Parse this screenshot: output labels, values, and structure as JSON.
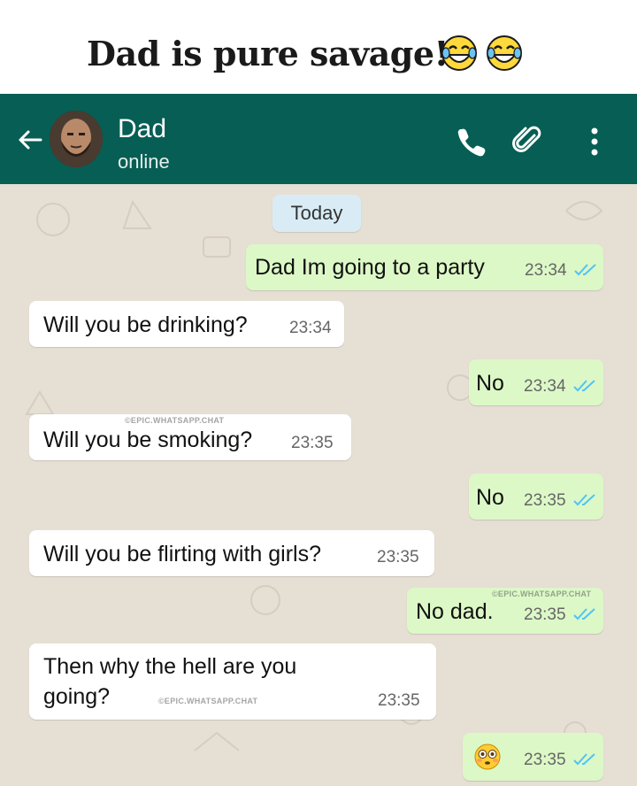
{
  "caption": {
    "text": "Dad is pure savage!",
    "emojis": [
      "tears-of-joy-emoji",
      "tears-of-joy-emoji"
    ]
  },
  "header": {
    "contact_name": "Dad",
    "status": "online",
    "icons": [
      "back-arrow-icon",
      "avatar",
      "phone-icon",
      "paperclip-icon",
      "more-vert-icon"
    ],
    "color": "#075e54"
  },
  "chat": {
    "background": "#e6dfd4",
    "date_label": "Today",
    "messages": [
      {
        "dir": "out",
        "text": "Dad Im going to a party",
        "time": "23:34",
        "status": "read"
      },
      {
        "dir": "in",
        "text": "Will you be drinking?",
        "time": "23:34"
      },
      {
        "dir": "out",
        "text": "No",
        "time": "23:34",
        "status": "read"
      },
      {
        "dir": "in",
        "text": "Will you be smoking?",
        "time": "23:35"
      },
      {
        "dir": "out",
        "text": "No",
        "time": "23:35",
        "status": "read"
      },
      {
        "dir": "in",
        "text": "Will you be flirting with girls?",
        "time": "23:35"
      },
      {
        "dir": "out",
        "text": "No dad.",
        "time": "23:35",
        "status": "read"
      },
      {
        "dir": "in",
        "text_line1": "Then why the hell are you",
        "text_line2": "going?",
        "time": "23:35"
      },
      {
        "dir": "out",
        "emoji": "flushed-face-emoji",
        "time": "23:35",
        "status": "read"
      }
    ],
    "watermark": "©EPIC.WHATSAPP.CHAT"
  },
  "colors": {
    "incoming_bubble": "#ffffff",
    "outgoing_bubble": "#dcf8c6",
    "read_ticks": "#4fc3f7",
    "date_chip": "#d9ecf5"
  }
}
